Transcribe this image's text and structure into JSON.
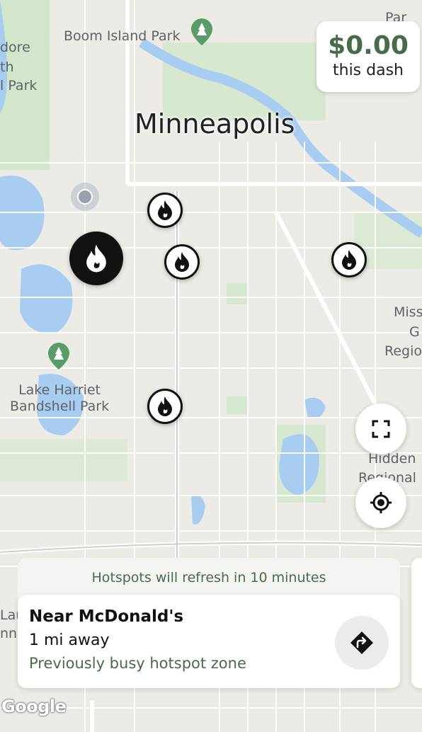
{
  "map": {
    "city_label": "Minneapolis",
    "labels": [
      {
        "id": "boom-island",
        "text": "Boom Island Park"
      },
      {
        "id": "dore",
        "text": "dore"
      },
      {
        "id": "th",
        "text": "th"
      },
      {
        "id": "l-park",
        "text": "l Park"
      },
      {
        "id": "lake-harriet",
        "text": "Lake Harriet\nBandshell Park"
      },
      {
        "id": "miss",
        "text": "Miss"
      },
      {
        "id": "g",
        "text": "G"
      },
      {
        "id": "regio",
        "text": "Regio"
      },
      {
        "id": "hidden",
        "text": "Hidden"
      },
      {
        "id": "regional",
        "text": "Regional"
      },
      {
        "id": "laude",
        "text": "Laude"
      },
      {
        "id": "nni",
        "text": "nni"
      },
      {
        "id": "par",
        "text": "Par"
      }
    ],
    "attribution": "Google"
  },
  "earnings": {
    "amount": "$0.00",
    "label": "this dash"
  },
  "hotspot_panel": {
    "refresh_notice": "Hotspots will refresh in 10 minutes",
    "title": "Near McDonald's",
    "distance": "1 mi away",
    "status": "Previously busy hotspot zone"
  },
  "icons": {
    "hotspot": "flame-icon",
    "fullscreen": "expand-icon",
    "recenter": "crosshair-icon",
    "directions": "turn-right-arrow-icon"
  },
  "colors": {
    "accent_green": "#4a6b4a",
    "map_background": "#ecebe6",
    "water": "#a8cdf0",
    "park": "#c9e3c3",
    "hotspot_dark": "#111111"
  }
}
